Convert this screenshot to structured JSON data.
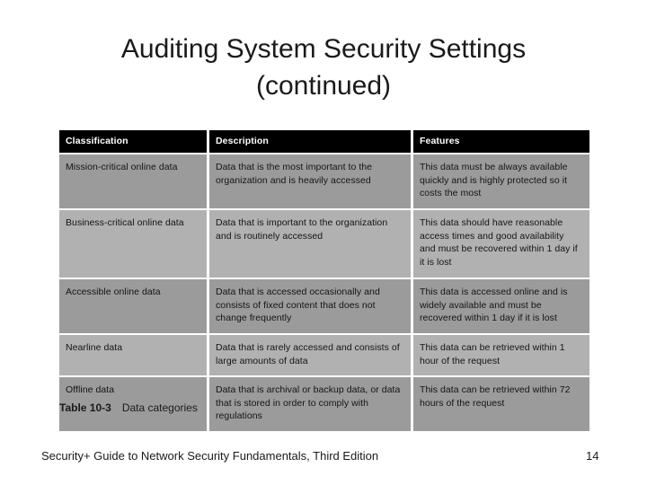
{
  "slide": {
    "title_line1": "Auditing System Security Settings",
    "title_line2": "(continued)"
  },
  "table": {
    "headers": [
      "Classification",
      "Description",
      "Features"
    ],
    "rows": [
      {
        "classification": "Mission-critical online data",
        "description": "Data that is the most important to the organization and is heavily accessed",
        "features": "This data must be always available quickly and is highly protected so it costs the most"
      },
      {
        "classification": "Business-critical online data",
        "description": "Data that is important to the organization and is routinely accessed",
        "features": "This data should have reasonable access times and good availability and must be recovered within 1 day if it is lost"
      },
      {
        "classification": "Accessible online data",
        "description": "Data that is accessed occasionally and consists of fixed content that does not change frequently",
        "features": "This data is accessed online and is widely available and must be recovered within 1 day if it is lost"
      },
      {
        "classification": "Nearline data",
        "description": "Data that is rarely accessed and consists of large amounts of data",
        "features": "This data can be retrieved within 1 hour of the request"
      },
      {
        "classification": "Offline data",
        "description": "Data that is archival or backup data, or data that is stored in order to comply with regulations",
        "features": "This data can be retrieved within 72 hours of the request"
      }
    ],
    "caption_label": "Table 10-3",
    "caption_text": "Data categories",
    "colors": {
      "header_background": "#000000",
      "header_text": "#ffffff",
      "band_dark": "#9b9b9b",
      "band_light": "#b1b1b1",
      "body_text": "#141414"
    }
  },
  "footer": {
    "source": "Security+ Guide to Network Security Fundamentals, Third Edition",
    "page_number": "14"
  }
}
